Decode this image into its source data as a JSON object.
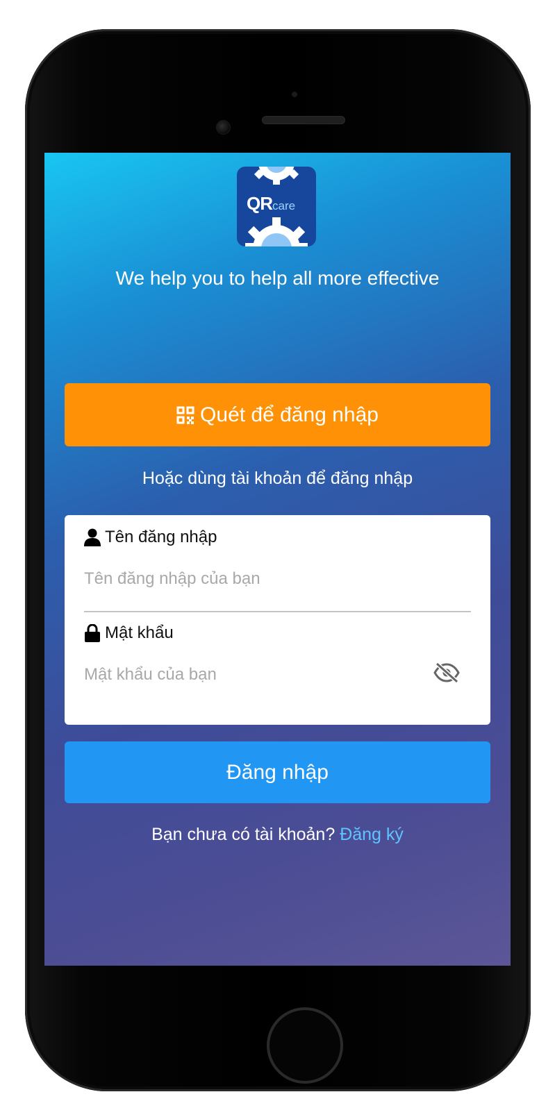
{
  "logo": {
    "text_main": "QR",
    "text_sub": "care"
  },
  "tagline": "We help you to help all more effective",
  "scan_button": {
    "label": "Quét để đăng nhập",
    "icon": "qr-code-icon",
    "color": "#ff9107"
  },
  "or_text": "Hoặc dùng tài khoản để đăng nhập",
  "form": {
    "username": {
      "label": "Tên đăng nhập",
      "placeholder": "Tên đăng nhập của bạn",
      "value": "",
      "icon": "user-icon"
    },
    "password": {
      "label": "Mật khẩu",
      "placeholder": "Mật khẩu của bạn",
      "value": "",
      "icon": "lock-icon",
      "toggle_icon": "eye-off-icon"
    }
  },
  "login_button": {
    "label": "Đăng nhập",
    "color": "#2196f3"
  },
  "signup": {
    "prompt": "Bạn chưa có tài khoản?",
    "link": "Đăng ký",
    "link_color": "#5ec4ff"
  }
}
